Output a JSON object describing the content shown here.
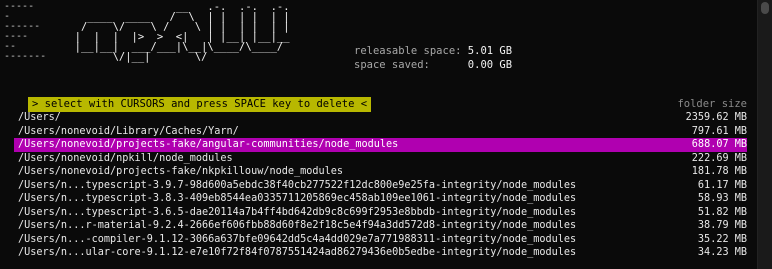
{
  "window": {
    "colors": {
      "background": "#0a0a0a",
      "prompt_bg": "#b8b800",
      "selection_bg": "#b000b0"
    }
  },
  "logo_art": [
    "                  __   .-.  .-.  .-. ",
    "    ____  ____   /  \\  | |  | |  | | ",
    "   /    \\/    \\ /    \\ | |  | |  | | ",
    "  |  |  |  |>  >  <|   | |__| |__|__ ",
    "  |__|__|  ___/___|\\__|\\____/\\____/ ",
    "        \\/|__|       \\/              "
  ],
  "decor_dashes": [
    "-----",
    "-",
    "------",
    "----",
    "--",
    "-------"
  ],
  "stats": {
    "releasable_label": "releasable space:",
    "releasable_value": "5.01 GB",
    "saved_label": "space saved:",
    "saved_value": "0.00 GB"
  },
  "header": {
    "prompt": "> select with CURSORS and press SPACE key to delete <",
    "column": "folder size"
  },
  "rows": [
    {
      "path": "/Users/",
      "size": "2359.62 MB",
      "selected": false
    },
    {
      "path": "/Users/nonevoid/Library/Caches/Yarn/",
      "size": "797.61 MB",
      "selected": false
    },
    {
      "path": "/Users/nonevoid/projects-fake/angular-communities/node_modules",
      "size": "688.07 MB",
      "selected": true
    },
    {
      "path": "/Users/nonevoid/npkill/node_modules",
      "size": "222.69 MB",
      "selected": false
    },
    {
      "path": "/Users/nonevoid/projects-fake/nkpkillouw/node_modules",
      "size": "181.78 MB",
      "selected": false
    },
    {
      "path": "/Users/n...typescript-3.9.7-98d600a5ebdc38f40cb277522f12dc800e9e25fa-integrity/node_modules",
      "size": "61.17 MB",
      "selected": false
    },
    {
      "path": "/Users/n...typescript-3.8.3-409eb8544ea0335711205869ec458ab109ee1061-integrity/node_modules",
      "size": "58.93 MB",
      "selected": false
    },
    {
      "path": "/Users/n...typescript-3.6.5-dae20114a7b4ff4bd642db9c8c699f2953e8bbdb-integrity/node_modules",
      "size": "51.82 MB",
      "selected": false
    },
    {
      "path": "/Users/n...r-material-9.2.4-2666ef606fbb88d60f8e2f18c5e4f94a3dd572d8-integrity/node_modules",
      "size": "38.79 MB",
      "selected": false
    },
    {
      "path": "/Users/n...-compiler-9.1.12-3066a637bfe09642dd5c4a4dd029e7a771988311-integrity/node_modules",
      "size": "35.22 MB",
      "selected": false
    },
    {
      "path": "/Users/n...ular-core-9.1.12-e7e10f72f84f0787551424ad86279436e0b5edbe-integrity/node_modules",
      "size": "34.23 MB",
      "selected": false
    }
  ]
}
